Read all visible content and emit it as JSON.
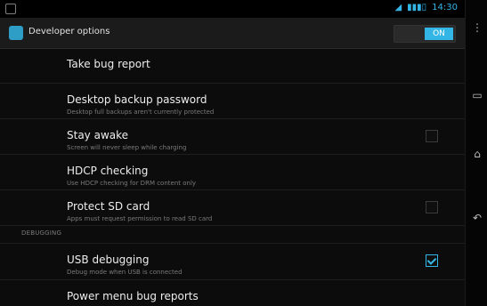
{
  "status_bar": {
    "time": "14:30",
    "battery": "▮▮▮▯",
    "wifi_icon": "wifi-icon",
    "signal_icon": "signal-icon"
  },
  "action_bar": {
    "title": "Developer options",
    "toggle_label": "ON"
  },
  "list": {
    "items": [
      {
        "title": "Take bug report",
        "subtitle": ""
      },
      {
        "title": "Desktop backup password",
        "subtitle": "Desktop full backups aren't currently protected"
      },
      {
        "title": "Stay awake",
        "subtitle": "Screen will never sleep while charging",
        "checked": false
      },
      {
        "title": "HDCP checking",
        "subtitle": "Use HDCP checking for DRM content only"
      },
      {
        "title": "Protect SD card",
        "subtitle": "Apps must request permission to read SD card",
        "checked": false
      }
    ],
    "section_debugging": "DEBUGGING",
    "usb_debugging": {
      "title": "USB debugging",
      "subtitle": "Debug mode when USB is connected",
      "checked": true
    },
    "power_menu": {
      "title": "Power menu bug reports",
      "subtitle": ""
    }
  },
  "nav_bar": {
    "back_icon": "back-icon",
    "home_icon": "home-icon",
    "recents_icon": "recents-icon"
  }
}
